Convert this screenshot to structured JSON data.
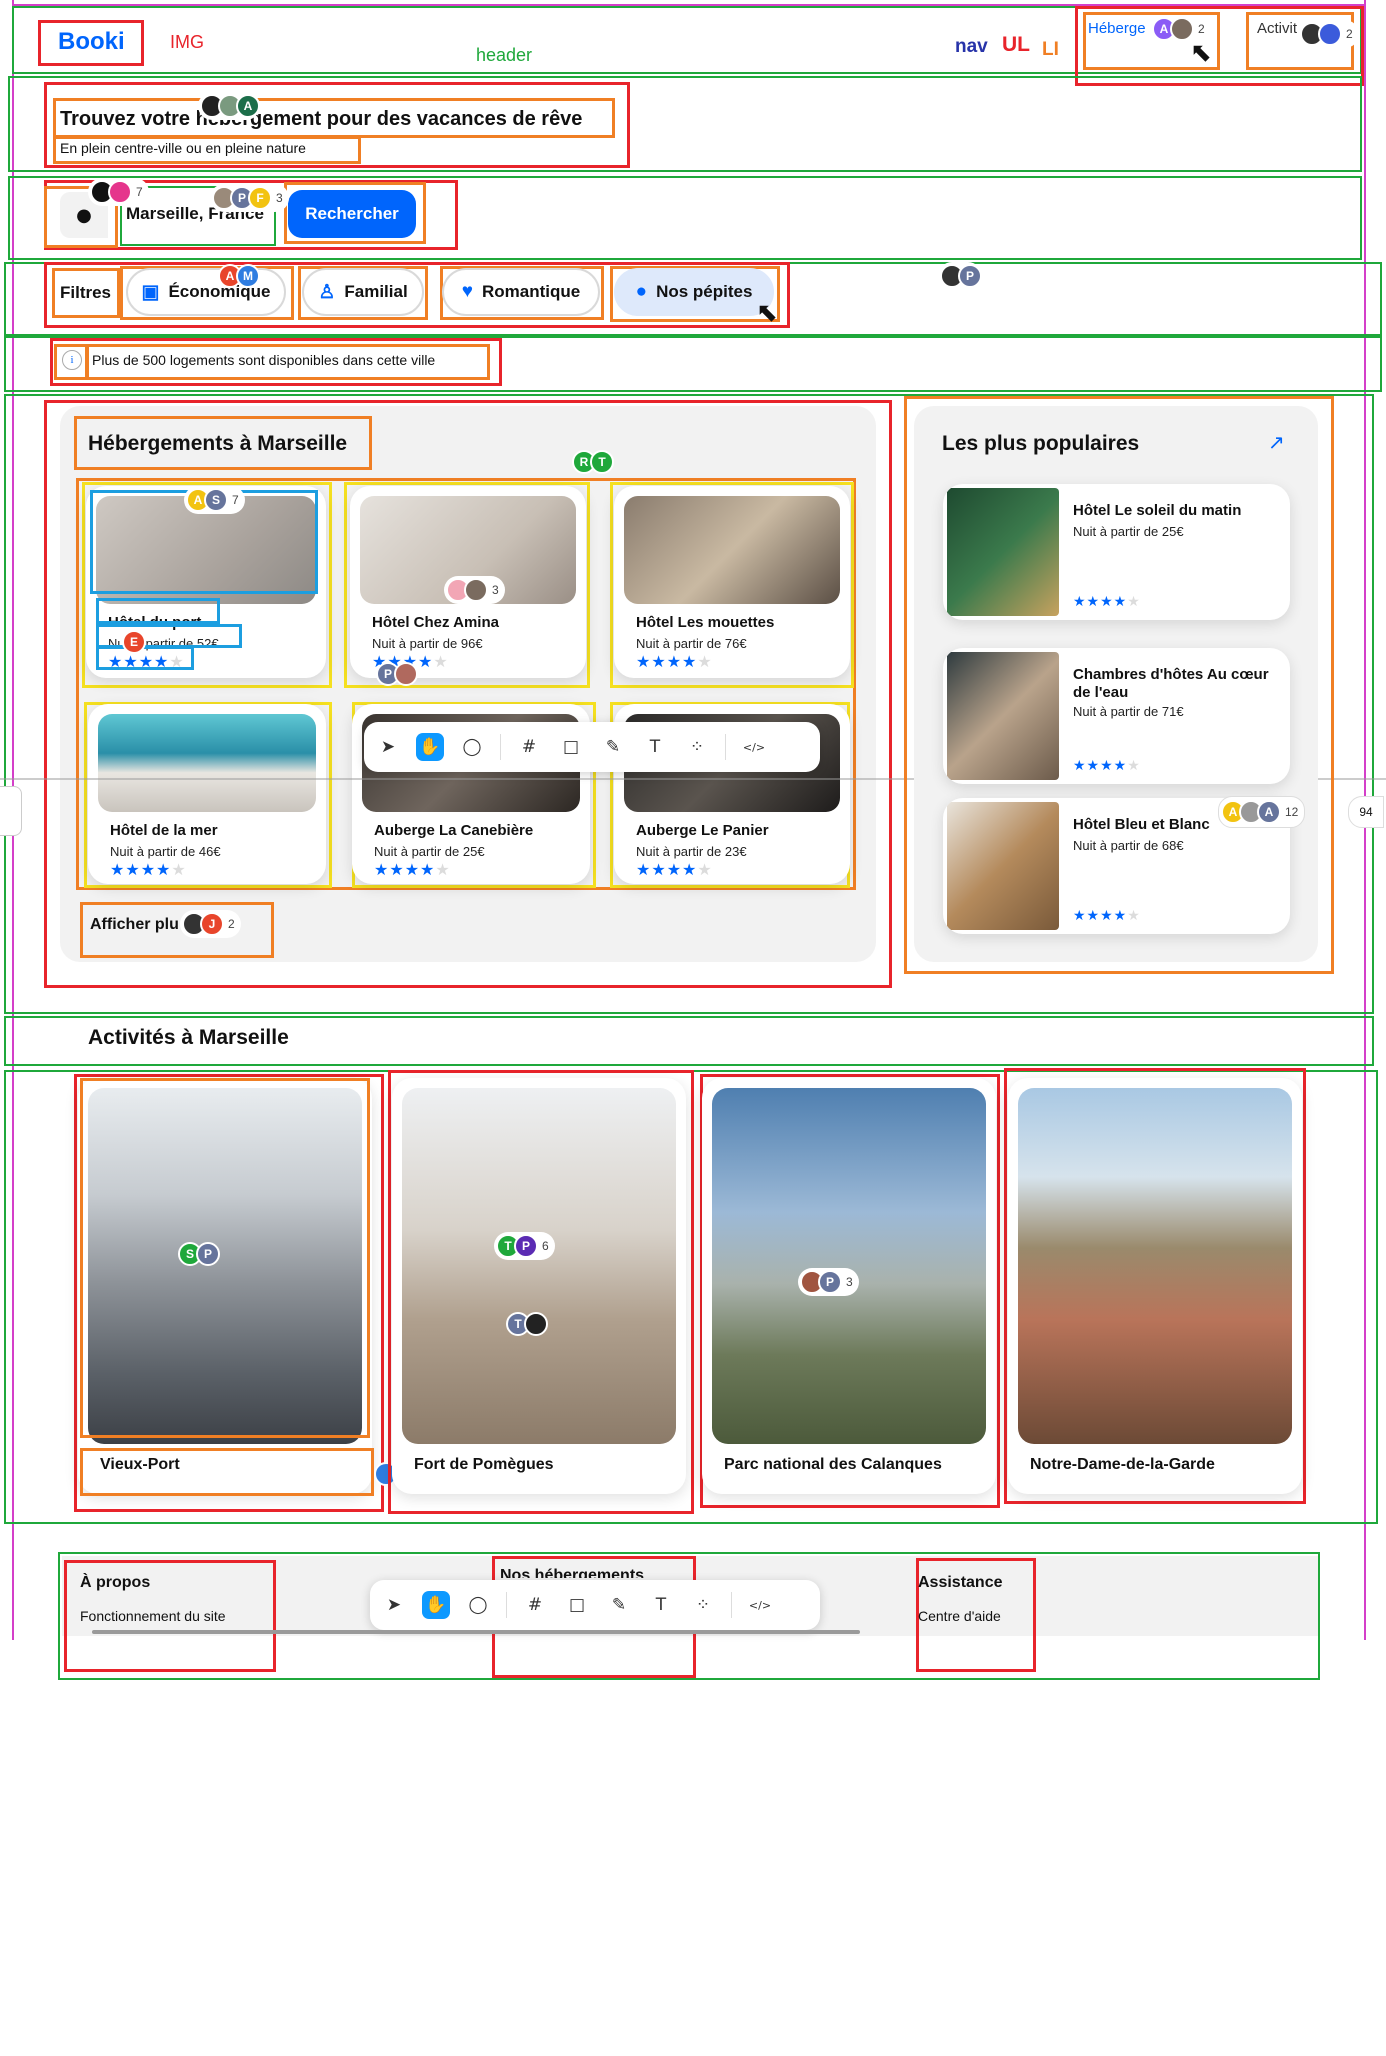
{
  "dev_labels": {
    "img": "IMG",
    "header": "header",
    "nav": "nav",
    "ul": "UL",
    "li": "LI"
  },
  "header": {
    "logo": "Booki",
    "nav_items": [
      {
        "label": "Héberge",
        "avatars": [
          "A"
        ],
        "count": "2"
      },
      {
        "label": "Activit",
        "count": "2"
      }
    ]
  },
  "hero": {
    "title": "Trouvez votre hébergement pour des vacances de rêve",
    "subtitle": "En plein centre-ville ou en pleine nature"
  },
  "search": {
    "location_value": "Marseille, France",
    "submit_label": "Rechercher",
    "presence_1": {
      "count": "7"
    },
    "presence_2": {
      "avatars": [
        "P",
        "F"
      ],
      "count": "3"
    }
  },
  "filters": {
    "label": "Filtres",
    "items": [
      {
        "label": "Économique",
        "icon": "money-icon"
      },
      {
        "label": "Familial",
        "icon": "person-icon"
      },
      {
        "label": "Romantique",
        "icon": "heart-icon"
      },
      {
        "label": "Nos pépites",
        "icon": "fire-icon"
      }
    ],
    "presence_econ": [
      "A",
      "M"
    ],
    "presence_right": [
      "P"
    ]
  },
  "info": {
    "icon": "i",
    "text": "Plus de 500 logements sont disponibles dans cette ville"
  },
  "listings": {
    "title": "Hébergements à Marseille",
    "price_prefix": "Nuit à partir de ",
    "hotels": [
      {
        "name": "Hôtel du port",
        "price": "Nuit à partir de 52€",
        "rating": 4
      },
      {
        "name": "Hôtel Chez Amina",
        "price": "Nuit à partir de 96€",
        "rating": 4
      },
      {
        "name": "Hôtel Les mouettes",
        "price": "Nuit à partir de 76€",
        "rating": 4
      },
      {
        "name": "Hôtel de la mer",
        "price": "Nuit à partir de 46€",
        "rating": 4
      },
      {
        "name": "Auberge La Canebière",
        "price": "Nuit à partir de 25€",
        "rating": 4
      },
      {
        "name": "Auberge Le Panier",
        "price": "Nuit à partir de 23€",
        "rating": 4
      }
    ],
    "show_more": "Afficher plu",
    "show_more_count": "2",
    "presence": {
      "top": [
        "R",
        "T"
      ],
      "card1": {
        "avatars": [
          "A",
          "S"
        ],
        "count": "7"
      },
      "card1_price": [
        "E"
      ],
      "card2": {
        "count": "3"
      },
      "card2_bottom": [
        "P"
      ],
      "show_more": [
        "J"
      ]
    }
  },
  "popular": {
    "title": "Les plus populaires",
    "icon": "trend-chart-icon",
    "items": [
      {
        "name": "Hôtel Le soleil du matin",
        "price": "Nuit à partir de 25€",
        "rating": 4
      },
      {
        "name": "Chambres d'hôtes Au cœur de l'eau",
        "price": "Nuit à partir de 71€",
        "rating": 4
      },
      {
        "name": "Hôtel Bleu et Blanc",
        "price": "Nuit à partir de 68€",
        "rating": 4
      }
    ],
    "presence": {
      "avatars": [
        "A",
        "A"
      ],
      "count": "12",
      "extra": "94"
    }
  },
  "activities": {
    "title": "Activités à Marseille",
    "items": [
      {
        "name": "Vieux-Port"
      },
      {
        "name": "Fort de Pomègues"
      },
      {
        "name": "Parc national des Calanques"
      },
      {
        "name": "Notre-Dame-de-la-Garde"
      }
    ],
    "presence": {
      "a1": [
        "S",
        "P"
      ],
      "a2": {
        "avatars": [
          "T",
          "P"
        ],
        "count": "6"
      },
      "a2b": [
        "T"
      ],
      "a3": {
        "avatars": [
          "P"
        ],
        "count": "3"
      },
      "a1b": [
        "M"
      ]
    }
  },
  "footer": {
    "col1_title": "À propos",
    "col1_link": "Fonctionnement du site",
    "col2_title": "Nos hébergements",
    "col3_title": "Assistance",
    "col3_link": "Centre d'aide"
  },
  "colors": {
    "primary": "#0065fc",
    "annotation_red": "#e8242b",
    "annotation_orange": "#f07f24",
    "annotation_green": "#1fa83b",
    "annotation_yellow": "#f5e020",
    "annotation_blue": "#1c9ee0"
  }
}
